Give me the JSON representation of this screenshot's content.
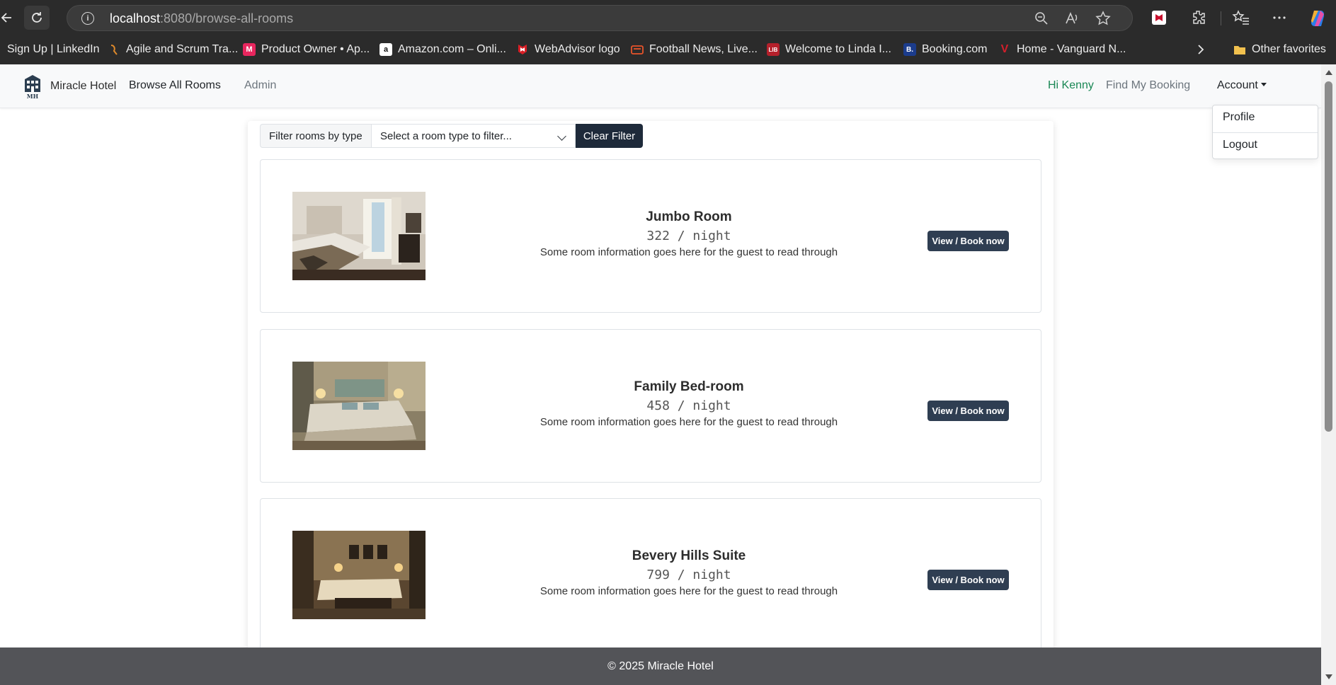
{
  "browser": {
    "url_host": "localhost",
    "url_path": ":8080/browse-all-rooms",
    "bookmarks": [
      {
        "label": "Sign Up | LinkedIn",
        "icon": "linkedin-icon"
      },
      {
        "label": "Agile and Scrum Tra...",
        "icon": "agile-icon"
      },
      {
        "label": "Product Owner • Ap...",
        "icon": "product-owner-icon",
        "glyph": "M",
        "color": "#e8265e"
      },
      {
        "label": "Amazon.com – Onli...",
        "icon": "amazon-icon",
        "glyph": "a",
        "color": "#ffffff"
      },
      {
        "label": "WebAdvisor logo",
        "icon": "mcafee-icon",
        "color": "#d81f26"
      },
      {
        "label": "Football News, Live...",
        "icon": "football-news-icon",
        "color": "#e8542b"
      },
      {
        "label": "Welcome to Linda I...",
        "icon": "lib-icon",
        "glyph": "LIB",
        "color": "#b5202b"
      },
      {
        "label": "Booking.com",
        "icon": "booking-icon",
        "glyph": "B.",
        "color": "#1b3c8c"
      },
      {
        "label": "Home - Vanguard N...",
        "icon": "vanguard-icon",
        "glyph": "V",
        "color": "#96151d"
      }
    ],
    "other_favorites": "Other favorites"
  },
  "navbar": {
    "brand": "Miracle Hotel",
    "logo_text": "MH",
    "links": {
      "browse": "Browse All Rooms",
      "admin": "Admin",
      "greeting": "Hi Kenny",
      "find_booking": "Find My Booking",
      "account": "Account"
    },
    "account_menu": [
      "Profile",
      "Logout"
    ]
  },
  "filter": {
    "label": "Filter rooms by type",
    "select_value": "Select a room type to filter...",
    "clear_label": "Clear Filter"
  },
  "rooms": [
    {
      "type": "Jumbo Room",
      "price": "322 / night",
      "description": "Some room information goes here for the guest to read through",
      "button": "View / Book now"
    },
    {
      "type": "Family Bed-room",
      "price": "458 / night",
      "description": "Some room information goes here for the guest to read through",
      "button": "View / Book now"
    },
    {
      "type": "Bevery Hills Suite",
      "price": "799 / night",
      "description": "Some room information goes here for the guest to read through",
      "button": "View / Book now"
    }
  ],
  "footer": "© 2025 Miracle Hotel",
  "colors": {
    "navbar_bg": "#f8f9fa",
    "greeting": "#198754",
    "button_dark": "#1e2a3a",
    "book_button": "#2f3e52",
    "footer_bg": "#535458"
  }
}
